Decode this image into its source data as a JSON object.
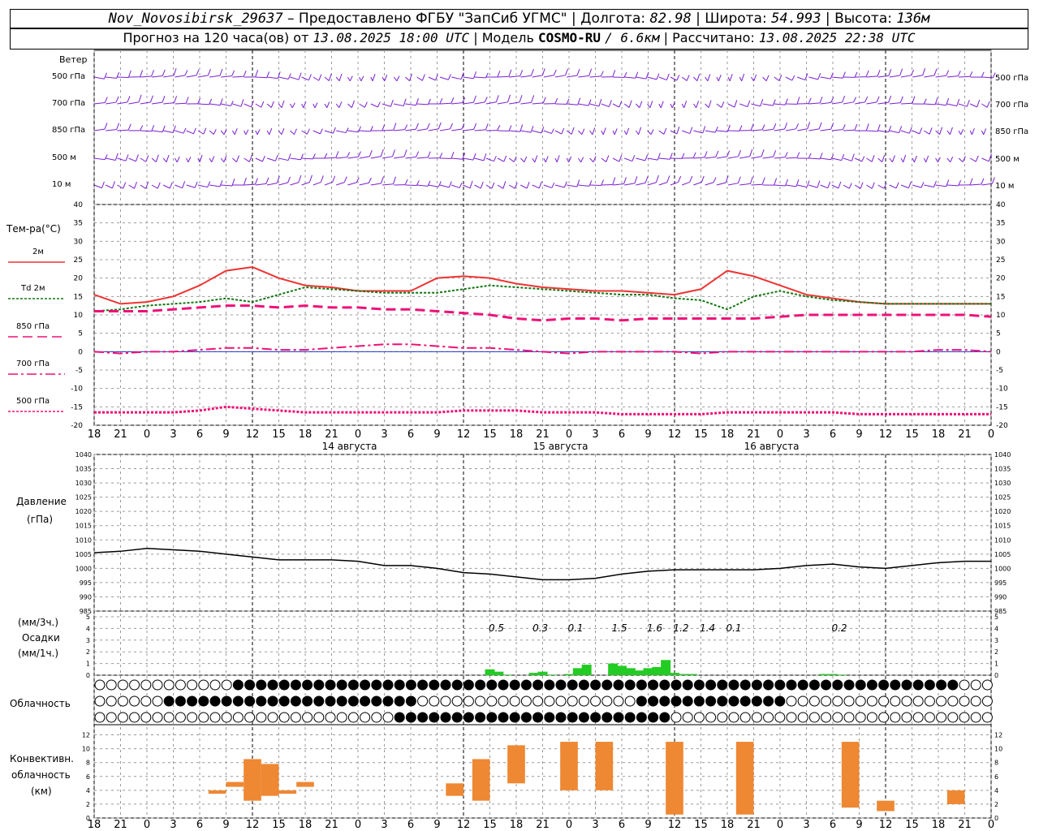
{
  "header": {
    "station": "Nov_Novosibirsk_29637",
    "provider": "– Предоставлено ФГБУ \"ЗапСиб УГМС\"",
    "lon_label": "Долгота:",
    "lon": "82.98",
    "lat_label": "Широта:",
    "lat": "54.993",
    "alt_label": "Высота:",
    "alt": "136м",
    "forecast_label": "Прогноз на 120 часа(ов) от",
    "forecast_time": "13.08.2025 18:00 UTC",
    "model_label": "| Модель",
    "model": "COSMO-RU",
    "model_res": "/ 6.6км",
    "calc_label": "| Рассчитано:",
    "calc_time": "13.08.2025 22:38 UTC"
  },
  "wind_panel": {
    "title": "Ветер",
    "levels": [
      "500 гПа",
      "700 гПа",
      "850 гПа",
      "500 м",
      "10 м"
    ]
  },
  "temp_panel": {
    "title": "Тем-ра(°C)",
    "legend": [
      "2м",
      "Td 2м",
      "850 гПа",
      "700 гПа",
      "500 гПа"
    ],
    "legend_colors": [
      "#ee3333",
      "#117711",
      "#ee1177",
      "#ee1177",
      "#ee1177"
    ]
  },
  "time_axis": {
    "hour_labels": [
      "18",
      "21",
      "0",
      "3",
      "6",
      "9",
      "12",
      "15",
      "18",
      "21",
      "0",
      "3",
      "6",
      "9",
      "12",
      "15",
      "18",
      "21",
      "0",
      "3",
      "6",
      "9",
      "12",
      "15",
      "18",
      "21",
      "0",
      "3",
      "6",
      "9",
      "12",
      "15",
      "18",
      "21",
      "0"
    ],
    "day_labels": [
      "14 августа",
      "15 августа",
      "16 августа"
    ]
  },
  "pressure_panel": {
    "title_line1": "Давление",
    "title_line2": "(гПа)"
  },
  "precip_panel": {
    "unit3": "(мм/3ч.)",
    "title": "Осадки",
    "unit1": "(мм/1ч.)",
    "totals_3h": [
      "0.5",
      "0.3",
      "0.1",
      "1.5",
      "1.6",
      "1.2",
      "1.4",
      "0.1",
      "0.2"
    ]
  },
  "cloud_panel": {
    "title": "Облачность"
  },
  "conv_panel": {
    "title_line1": "Конвективн.",
    "title_line2": "облачность",
    "title_line3": "(км)"
  },
  "chart_data": [
    {
      "type": "line",
      "title": "Тем-ра(°C)",
      "ylim": [
        -20,
        40
      ],
      "x_hours_from_start": [
        0,
        3,
        6,
        9,
        12,
        15,
        18,
        21,
        24,
        27,
        30,
        33,
        36,
        39,
        42,
        45,
        48,
        51,
        54,
        57,
        60,
        63,
        66,
        69,
        72,
        75,
        78,
        81,
        84,
        87,
        90,
        93,
        96,
        99,
        102
      ],
      "series": [
        {
          "name": "2м",
          "values": [
            15.5,
            13.0,
            13.5,
            15.0,
            18.0,
            22.0,
            23.0,
            20.0,
            18.0,
            17.5,
            16.5,
            16.5,
            16.5,
            20.0,
            20.5,
            20.0,
            18.5,
            17.5,
            17.0,
            16.5,
            16.5,
            16.0,
            15.5,
            17.0,
            22.0,
            20.5,
            18.0,
            15.5,
            14.5,
            13.5,
            13.0,
            13.0,
            13.0,
            13.0,
            13.0
          ]
        },
        {
          "name": "Td 2м",
          "values": [
            11.0,
            11.5,
            12.5,
            13.0,
            13.5,
            14.5,
            13.5,
            15.5,
            17.5,
            17.0,
            16.5,
            16.0,
            16.0,
            16.0,
            17.0,
            18.0,
            17.5,
            17.0,
            16.5,
            16.0,
            15.5,
            15.5,
            14.5,
            14.0,
            11.5,
            15.0,
            16.5,
            15.0,
            14.0,
            13.5,
            13.0,
            13.0,
            13.0,
            13.0,
            13.0
          ]
        },
        {
          "name": "850 гПа",
          "values": [
            11.0,
            11.0,
            11.0,
            11.5,
            12.0,
            12.5,
            12.5,
            12.0,
            12.5,
            12.0,
            12.0,
            11.5,
            11.5,
            11.0,
            10.5,
            10.0,
            9.0,
            8.5,
            9.0,
            9.0,
            8.5,
            9.0,
            9.0,
            9.0,
            9.0,
            9.0,
            9.5,
            10.0,
            10.0,
            10.0,
            10.0,
            10.0,
            10.0,
            10.0,
            9.5
          ]
        },
        {
          "name": "700 гПа",
          "values": [
            0.0,
            -0.5,
            0.0,
            0.0,
            0.5,
            1.0,
            1.0,
            0.5,
            0.5,
            1.0,
            1.5,
            2.0,
            2.0,
            1.5,
            1.0,
            1.0,
            0.5,
            0.0,
            -0.5,
            0.0,
            0.0,
            0.0,
            0.0,
            -0.5,
            0.0,
            0.0,
            0.0,
            0.0,
            0.0,
            0.0,
            0.0,
            0.0,
            0.5,
            0.5,
            0.0
          ]
        },
        {
          "name": "500 гПа",
          "values": [
            -16.5,
            -16.5,
            -16.5,
            -16.5,
            -16.0,
            -15.0,
            -15.5,
            -16.0,
            -16.5,
            -16.5,
            -16.5,
            -16.5,
            -16.5,
            -16.5,
            -16.0,
            -16.0,
            -16.0,
            -16.5,
            -16.5,
            -16.5,
            -17.0,
            -17.0,
            -17.0,
            -17.0,
            -16.5,
            -16.5,
            -16.5,
            -16.5,
            -16.5,
            -17.0,
            -17.0,
            -17.0,
            -17.0,
            -17.0,
            -17.0
          ]
        }
      ]
    },
    {
      "type": "line",
      "title": "Давление (гПа)",
      "ylim": [
        985,
        1040
      ],
      "x_hours_from_start": [
        0,
        3,
        6,
        9,
        12,
        15,
        18,
        21,
        24,
        27,
        30,
        33,
        36,
        39,
        42,
        45,
        48,
        51,
        54,
        57,
        60,
        63,
        66,
        69,
        72,
        75,
        78,
        81,
        84,
        87,
        90,
        93,
        96,
        99,
        102
      ],
      "series": [
        {
          "name": "Давление",
          "values": [
            1005.5,
            1006,
            1007,
            1006.5,
            1006,
            1005,
            1004,
            1003,
            1003,
            1003,
            1002.5,
            1001,
            1001,
            1000,
            998.5,
            998,
            997,
            996,
            996,
            996.5,
            998,
            999,
            999.5,
            999.5,
            999.5,
            999.5,
            1000,
            1001,
            1001.5,
            1000.5,
            1000,
            1001,
            1002,
            1002.5,
            1002.5
          ]
        }
      ]
    },
    {
      "type": "bar",
      "title": "Осадки (мм/1ч.)",
      "ylim": [
        0,
        5
      ],
      "x_hours_from_start": [
        45,
        46,
        47,
        50,
        51,
        52,
        54,
        55,
        56,
        59,
        60,
        61,
        62,
        63,
        64,
        65,
        66,
        67,
        68,
        83,
        84,
        85
      ],
      "values": [
        0.5,
        0.3,
        0.05,
        0.2,
        0.3,
        0.05,
        0.1,
        0.6,
        0.9,
        1.0,
        0.8,
        0.6,
        0.4,
        0.6,
        0.7,
        1.3,
        0.2,
        0.1,
        0.1,
        0.1,
        0.1,
        0.05
      ]
    },
    {
      "type": "bar",
      "title": "Конвективн. облачность (км)",
      "ylim": [
        0,
        13
      ],
      "x_hours_from_start": [
        12,
        13,
        14,
        15,
        16,
        17,
        18
      ],
      "values_note_omitted": true
    }
  ]
}
